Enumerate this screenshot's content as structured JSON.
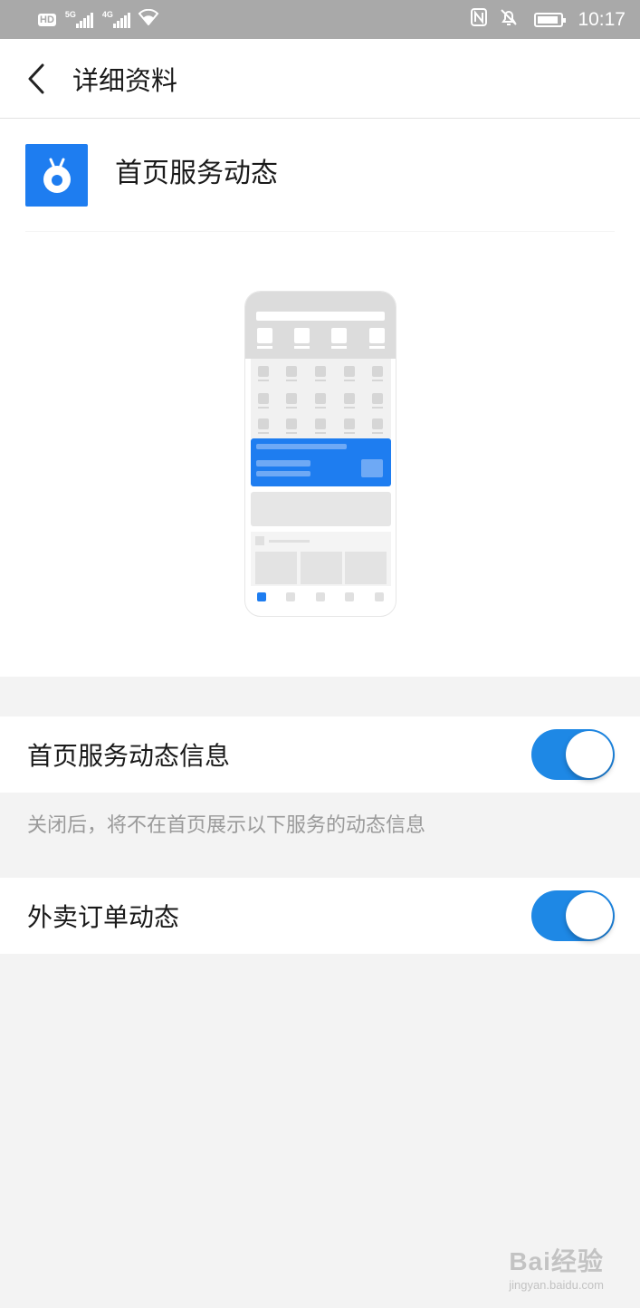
{
  "status_bar": {
    "hd_label": "HD",
    "sim1_gen": "5G",
    "sim2_gen": "4G",
    "time": "10:17"
  },
  "header": {
    "title": "详细资料"
  },
  "app": {
    "name": "首页服务动态",
    "accent_color": "#1e7df0"
  },
  "settings": [
    {
      "label": "首页服务动态信息",
      "enabled": true
    },
    {
      "label": "外卖订单动态",
      "enabled": true
    }
  ],
  "hint": "关闭后，将不在首页展示以下服务的动态信息",
  "watermark": {
    "main": "Bai经验",
    "sub": "jingyan.baidu.com"
  }
}
